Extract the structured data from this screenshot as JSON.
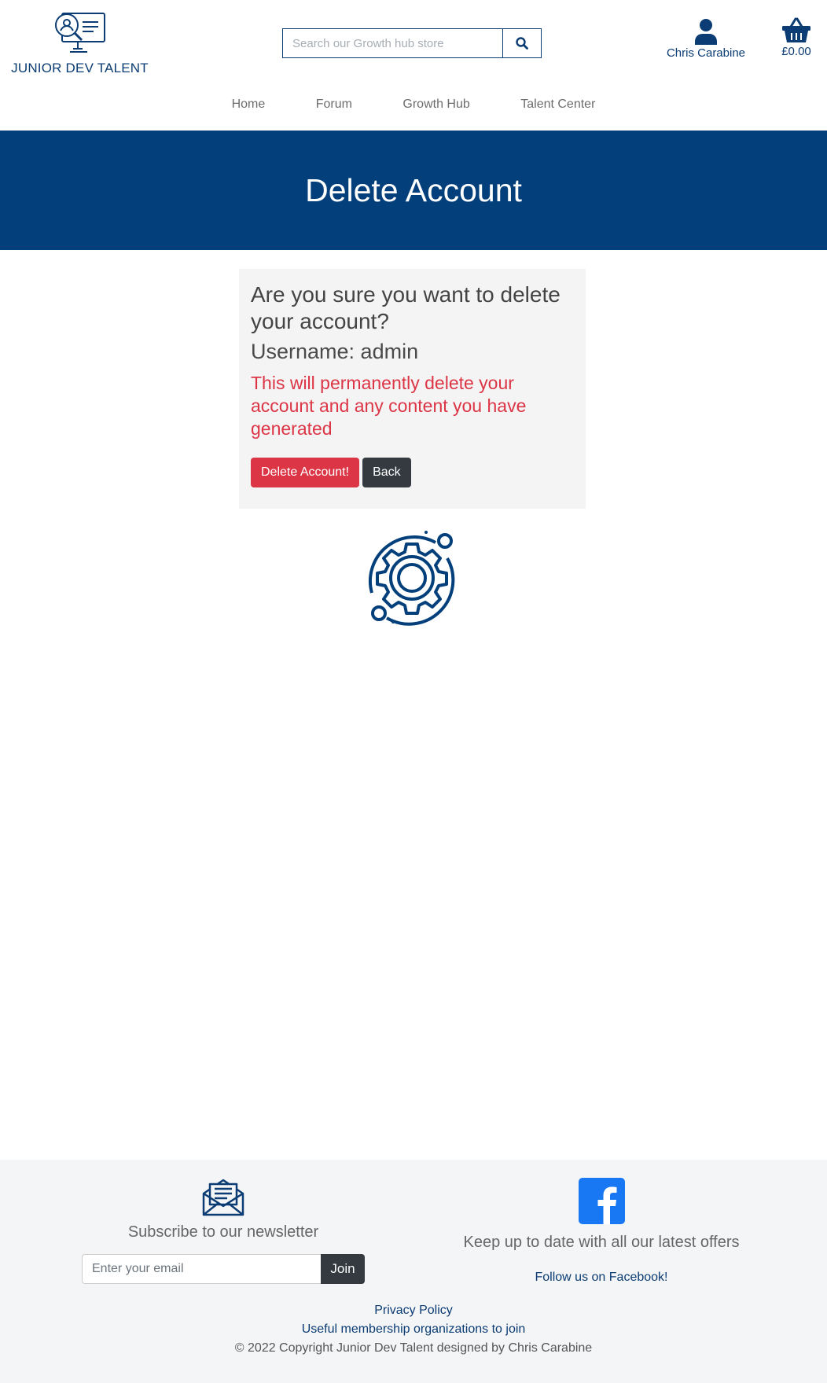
{
  "brand": {
    "name": "JUNIOR DEV TALENT",
    "logo_icon": "monitor-user-magnifier-icon"
  },
  "search": {
    "placeholder": "Search our Growth hub store",
    "icon": "search-icon"
  },
  "account": {
    "name": "Chris Carabine",
    "icon": "user-icon"
  },
  "basket": {
    "total": "£0.00",
    "icon": "basket-icon"
  },
  "nav": {
    "items": [
      {
        "label": "Home"
      },
      {
        "label": "Forum"
      },
      {
        "label": "Growth Hub"
      },
      {
        "label": "Talent Center"
      }
    ]
  },
  "banner": {
    "title": "Delete Account"
  },
  "confirm": {
    "question": "Are you sure you want to delete your account?",
    "username_label": "Username: admin",
    "warning": "This will permanently delete your account and any content you have generated",
    "delete_label": "Delete Account!",
    "back_label": "Back"
  },
  "decoration": {
    "icon": "gear-orbit-icon"
  },
  "footer": {
    "newsletter": {
      "icon": "envelope-open-icon",
      "text": "Subscribe to our newsletter",
      "placeholder": "Enter your email",
      "button": "Join"
    },
    "social": {
      "icon": "facebook-icon",
      "text": "Keep up to date with all our latest offers",
      "link": "Follow us on Facebook!"
    },
    "links": {
      "privacy": "Privacy Policy",
      "memberships": "Useful membership organizations to join"
    },
    "copyright": "© 2022 Copyright Junior Dev Talent designed by Chris Carabine"
  },
  "colors": {
    "brand": "#033f7b",
    "danger": "#dc3545",
    "dark": "#343a40",
    "card_bg": "#f4f4f5",
    "footer_bg": "#f4f5f7",
    "facebook": "#1877f2"
  }
}
